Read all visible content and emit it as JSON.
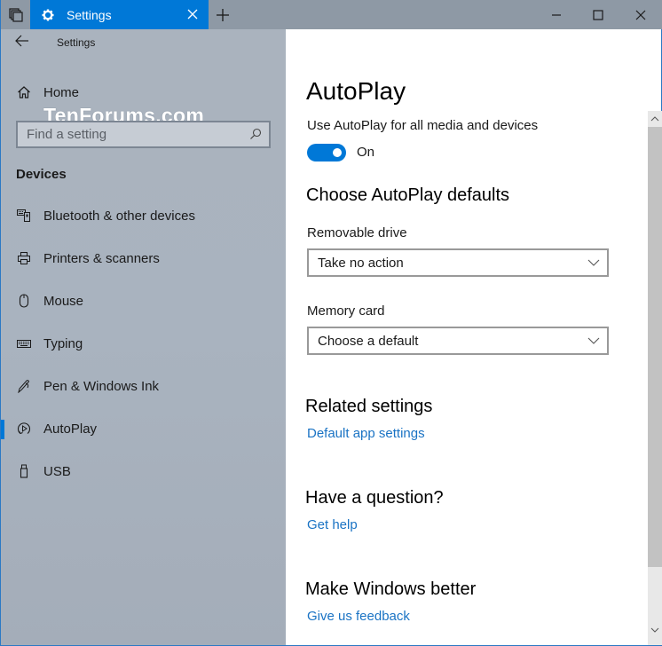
{
  "titlebar": {
    "tab_title": "Settings",
    "icons": {
      "task_view": "task-view-icon",
      "tab_icon": "gear-icon",
      "tab_close": "close-icon",
      "new_tab": "plus-icon",
      "minimize": "minimize-icon",
      "maximize": "maximize-icon",
      "close": "close-icon"
    }
  },
  "sidebar": {
    "back_title": "Settings",
    "home_label": "Home",
    "watermark": "TenForums.com",
    "search_placeholder": "Find a setting",
    "section_title": "Devices",
    "items": [
      {
        "label": "Bluetooth & other devices",
        "icon": "bluetooth-devices-icon",
        "active": false
      },
      {
        "label": "Printers & scanners",
        "icon": "printer-icon",
        "active": false
      },
      {
        "label": "Mouse",
        "icon": "mouse-icon",
        "active": false
      },
      {
        "label": "Typing",
        "icon": "keyboard-icon",
        "active": false
      },
      {
        "label": "Pen & Windows Ink",
        "icon": "pen-icon",
        "active": false
      },
      {
        "label": "AutoPlay",
        "icon": "autoplay-icon",
        "active": true
      },
      {
        "label": "USB",
        "icon": "usb-icon",
        "active": false
      }
    ]
  },
  "main": {
    "title": "AutoPlay",
    "autoplay_toggle": {
      "label": "Use AutoPlay for all media and devices",
      "state": "On",
      "on": true
    },
    "defaults_heading": "Choose AutoPlay defaults",
    "removable_drive": {
      "label": "Removable drive",
      "value": "Take no action"
    },
    "memory_card": {
      "label": "Memory card",
      "value": "Choose a default"
    },
    "related": {
      "heading": "Related settings",
      "link": "Default app settings"
    },
    "question": {
      "heading": "Have a question?",
      "link": "Get help"
    },
    "feedback": {
      "heading": "Make Windows better",
      "link": "Give us feedback"
    }
  },
  "colors": {
    "accent": "#0078d7",
    "link": "#1a73c4",
    "titlebar": "#8e99a5",
    "sidebar": "#a9b3bf"
  }
}
